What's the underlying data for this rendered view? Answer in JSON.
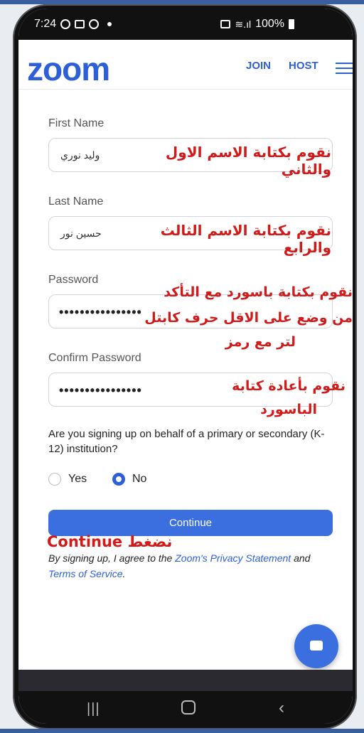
{
  "status_bar": {
    "time": "7:24",
    "battery": "100%"
  },
  "header": {
    "logo": "zoom",
    "join": "JOIN",
    "host": "HOST"
  },
  "form": {
    "first_name_label": "First Name",
    "first_name_value": "وليد نوري",
    "last_name_label": "Last Name",
    "last_name_value": "حسين نور",
    "password_label": "Password",
    "password_value": "••••••••••••••••",
    "confirm_label": "Confirm Password",
    "confirm_value": "••••••••••••••••",
    "question": "Are you signing up on behalf of a primary or secondary (K-12) institution?",
    "yes": "Yes",
    "no": "No",
    "continue": "Continue"
  },
  "annotations": {
    "first": "نقوم بكتابة الاسم الاول والثاني",
    "last": "نقوم بكتابة الاسم الثالث والرابع",
    "password_1": "نقوم بكتابة باسورد مع التأكد",
    "password_2": "من وضع على الاقل حرف كابتل",
    "password_3": "لتر مع رمز",
    "confirm_1": "نقوم بأعادة كتابة",
    "confirm_2": "الباسورد",
    "continue": "نضغط Continue"
  },
  "terms": {
    "prefix": "By signing up, I agree to the ",
    "privacy": "Zoom's Privacy Statement",
    "middle": " and ",
    "tos": "Terms of Service",
    "suffix": "."
  },
  "colors": {
    "brand": "#2d5fd6",
    "annotation": "#d11b1b",
    "button": "#3b6fe0"
  }
}
